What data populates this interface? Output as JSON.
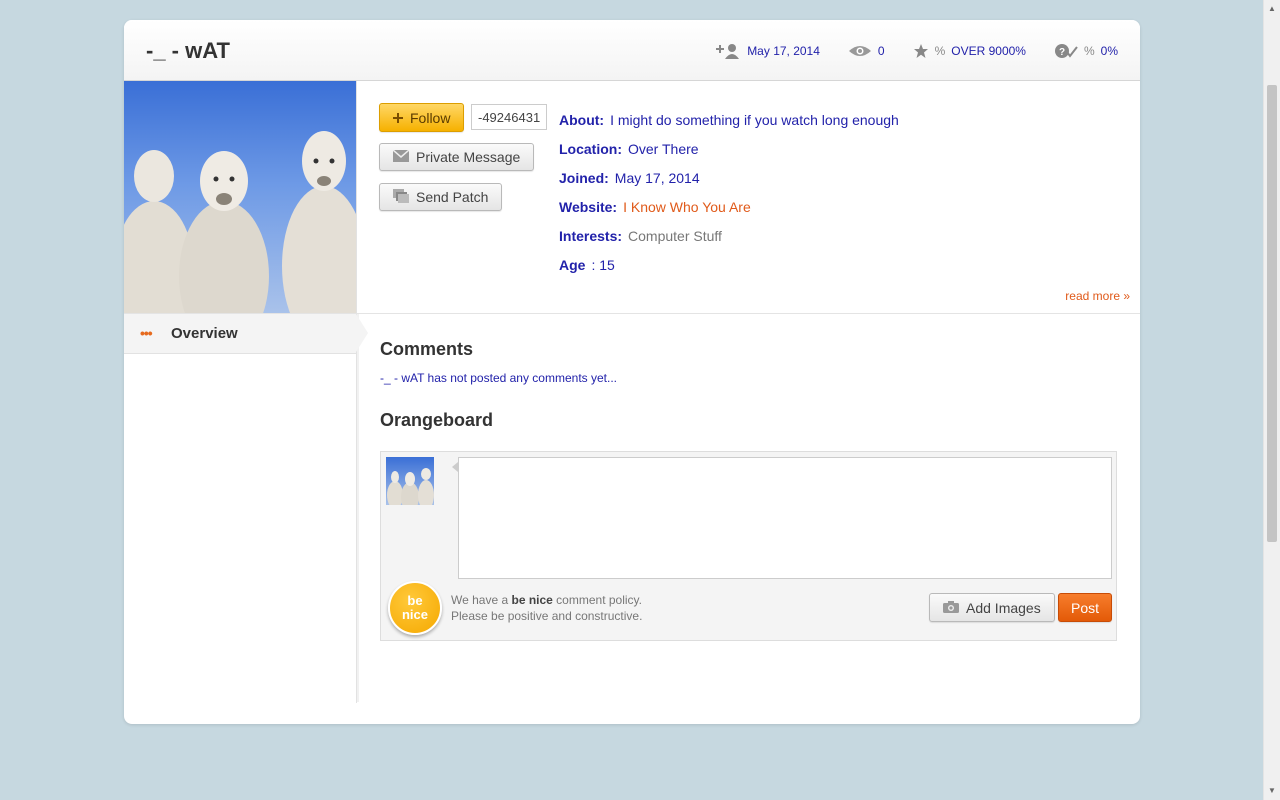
{
  "header": {
    "username": "-_ - wAT",
    "stats": {
      "joined_date": "May 17, 2014",
      "views": "0",
      "rating_pct_symbol": "%",
      "rating": "OVER 9000%",
      "answer_pct_symbol": "%",
      "answer_rate": "0%"
    }
  },
  "actions": {
    "follow_label": "Follow",
    "follow_count": "-49246431",
    "message_label": "Private Message",
    "patch_label": "Send Patch"
  },
  "about": {
    "about_key": "About:",
    "about_val": "I might do something if you watch long enough",
    "location_key": "Location:",
    "location_val": "Over There",
    "joined_key": "Joined:",
    "joined_val": "May 17, 2014",
    "website_key": "Website:",
    "website_val": "I Know Who You Are",
    "interests_key": "Interests:",
    "interests_val": "Computer Stuff",
    "age_key": "Age",
    "age_val": ": 15",
    "read_more": "read more »"
  },
  "sidenav": {
    "dots": "•••",
    "overview_label": "Overview"
  },
  "comments": {
    "title": "Comments",
    "empty_text": "-_ - wAT has not posted any comments yet..."
  },
  "orangeboard": {
    "title": "Orangeboard",
    "textarea_value": "",
    "badge_line1": "be",
    "badge_line2": "nice",
    "policy_prefix": "We have a ",
    "policy_bold": "be nice",
    "policy_suffix": " comment policy.",
    "policy_line2": "Please be positive and constructive.",
    "add_images_label": "Add Images",
    "post_label": "Post"
  },
  "icons": {
    "follow": "plus-icon",
    "message": "envelope-icon",
    "patch": "patch-icon",
    "joined": "add-user-icon",
    "views": "eye-icon",
    "rating": "star-icon",
    "answers": "question-check-icon",
    "camera": "camera-icon"
  },
  "colors": {
    "link_blue": "#2222aa",
    "accent_orange": "#e05a1a",
    "follow_yellow": "#f6b100",
    "background": "#c6d8e0"
  }
}
